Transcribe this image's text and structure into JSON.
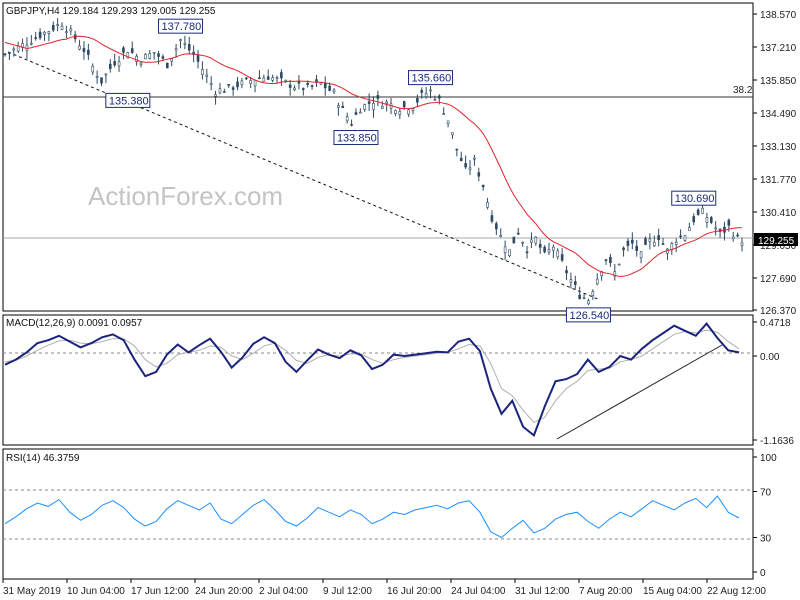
{
  "header": {
    "price_title": "GBPJPY,H4  129.184 129.293 129.005 129.255",
    "macd_title": "MACD(12,26,9) 0.0091 0.0957",
    "rsi_title": "RSI(14) 46.3759"
  },
  "watermark": "ActionForex.com",
  "colors": {
    "candles": "#2e4a62",
    "ma": "#e0242c",
    "macd": "#1a237e",
    "signal": "#b0b0b0",
    "rsi": "#1e90ff",
    "label_border": "#1a2c7a",
    "grid": "#c0c0c0"
  },
  "chart_data": [
    {
      "type": "candlestick",
      "symbol": "GBPJPY",
      "timeframe": "H4",
      "ohlc_last": {
        "open": 129.184,
        "high": 129.293,
        "low": 129.005,
        "close": 129.255
      },
      "ylim": [
        126.37,
        138.57
      ],
      "y_ticks": [
        "138.570",
        "137.210",
        "135.850",
        "134.490",
        "133.130",
        "131.770",
        "130.410",
        "129.050",
        "127.690",
        "126.370"
      ],
      "current_price": "129.255",
      "fib_level": {
        "label": "38.2",
        "value": 135.2
      },
      "moving_average_color": "#e0242c",
      "annotations": [
        {
          "text": "137.780",
          "value": 137.78
        },
        {
          "text": "135.380",
          "value": 135.38
        },
        {
          "text": "135.660",
          "value": 135.66
        },
        {
          "text": "133.850",
          "value": 133.85
        },
        {
          "text": "130.690",
          "value": 130.69
        },
        {
          "text": "126.540",
          "value": 126.54
        }
      ],
      "close_path": [
        [
          0,
          136.9
        ],
        [
          4,
          137.3
        ],
        [
          8,
          137.7
        ],
        [
          11,
          138.0
        ],
        [
          13,
          138.2
        ],
        [
          15,
          137.8
        ],
        [
          18,
          137.1
        ],
        [
          20,
          136.4
        ],
        [
          22,
          135.8
        ],
        [
          25,
          136.6
        ],
        [
          28,
          137.1
        ],
        [
          31,
          136.7
        ],
        [
          34,
          137.0
        ],
        [
          37,
          136.5
        ],
        [
          40,
          137.5
        ],
        [
          43,
          136.9
        ],
        [
          46,
          136.0
        ],
        [
          48,
          135.4
        ],
        [
          51,
          135.5
        ],
        [
          54,
          135.7
        ],
        [
          57,
          135.9
        ],
        [
          60,
          136.0
        ],
        [
          63,
          135.8
        ],
        [
          66,
          135.6
        ],
        [
          69,
          135.5
        ],
        [
          72,
          135.7
        ],
        [
          75,
          135.3
        ],
        [
          77,
          134.6
        ],
        [
          79,
          134.1
        ],
        [
          81,
          134.7
        ],
        [
          84,
          135.0
        ],
        [
          87,
          134.9
        ],
        [
          90,
          134.7
        ],
        [
          93,
          134.8
        ],
        [
          95,
          135.2
        ],
        [
          97,
          135.4
        ],
        [
          99,
          135.0
        ],
        [
          101,
          134.2
        ],
        [
          103,
          133.0
        ],
        [
          105,
          132.1
        ],
        [
          107,
          132.5
        ],
        [
          109,
          131.5
        ],
        [
          111,
          130.2
        ],
        [
          113,
          129.4
        ],
        [
          115,
          128.8
        ],
        [
          117,
          129.6
        ],
        [
          119,
          128.9
        ],
        [
          121,
          129.3
        ],
        [
          123,
          128.6
        ],
        [
          125,
          129.0
        ],
        [
          127,
          128.3
        ],
        [
          129,
          127.6
        ],
        [
          131,
          127.0
        ],
        [
          133,
          126.8
        ],
        [
          135,
          127.7
        ],
        [
          137,
          128.5
        ],
        [
          139,
          127.9
        ],
        [
          141,
          128.8
        ],
        [
          143,
          129.1
        ],
        [
          145,
          128.6
        ],
        [
          147,
          129.2
        ],
        [
          149,
          129.4
        ],
        [
          151,
          128.8
        ],
        [
          153,
          129.3
        ],
        [
          155,
          129.5
        ],
        [
          157,
          130.1
        ],
        [
          159,
          130.4
        ],
        [
          161,
          130.0
        ],
        [
          163,
          129.5
        ],
        [
          165,
          129.8
        ],
        [
          167,
          129.3
        ],
        [
          168,
          129.255
        ]
      ]
    },
    {
      "type": "line",
      "title": "MACD(12,26,9) 0.0091 0.0957",
      "ylim": [
        -1.1636,
        0.4718
      ],
      "y_ticks": [
        "0.4718",
        "0.00",
        "-1.1636"
      ],
      "series": [
        {
          "name": "MACD",
          "values": [
            -0.12,
            -0.05,
            0.05,
            0.18,
            0.22,
            0.28,
            0.2,
            0.12,
            0.18,
            0.26,
            0.3,
            0.22,
            -0.05,
            -0.28,
            -0.22,
            0.02,
            0.16,
            0.05,
            0.15,
            0.24,
            0.06,
            -0.16,
            -0.02,
            0.17,
            0.26,
            0.18,
            -0.08,
            -0.22,
            -0.06,
            0.09,
            0.02,
            -0.03,
            0.08,
            0.01,
            -0.18,
            -0.12,
            0.02,
            0.0,
            0.02,
            0.04,
            0.06,
            0.05,
            0.2,
            0.24,
            0.07,
            -0.45,
            -0.8,
            -0.62,
            -0.98,
            -1.1,
            -0.7,
            -0.35,
            -0.32,
            -0.25,
            -0.05,
            -0.22,
            -0.15,
            0.0,
            -0.05,
            0.1,
            0.22,
            0.32,
            0.42,
            0.35,
            0.28,
            0.45,
            0.25,
            0.08,
            0.05
          ]
        },
        {
          "name": "Signal",
          "values": [
            -0.08,
            -0.06,
            0.0,
            0.08,
            0.15,
            0.21,
            0.22,
            0.18,
            0.17,
            0.2,
            0.24,
            0.24,
            0.14,
            -0.05,
            -0.15,
            -0.1,
            0.02,
            0.05,
            0.08,
            0.14,
            0.12,
            0.0,
            -0.05,
            0.04,
            0.14,
            0.18,
            0.08,
            -0.06,
            -0.1,
            -0.02,
            0.02,
            0.0,
            0.03,
            0.03,
            -0.05,
            -0.1,
            -0.05,
            -0.02,
            0.0,
            0.02,
            0.04,
            0.05,
            0.1,
            0.16,
            0.14,
            -0.1,
            -0.45,
            -0.55,
            -0.75,
            -0.92,
            -0.85,
            -0.62,
            -0.45,
            -0.35,
            -0.2,
            -0.18,
            -0.17,
            -0.08,
            -0.05,
            0.0,
            0.1,
            0.2,
            0.3,
            0.34,
            0.32,
            0.36,
            0.33,
            0.2,
            0.1
          ]
        }
      ],
      "trendline": [
        [
          54,
          -1.1
        ],
        [
          165,
          0.1
        ]
      ]
    },
    {
      "type": "line",
      "title": "RSI(14) 46.3759",
      "ylim": [
        0,
        100
      ],
      "y_ticks": [
        "100",
        "70",
        "30",
        "0"
      ],
      "levels": [
        70,
        30
      ],
      "series": [
        {
          "name": "RSI",
          "values": [
            42,
            48,
            55,
            60,
            57,
            63,
            52,
            45,
            50,
            58,
            62,
            56,
            46,
            40,
            44,
            55,
            62,
            58,
            54,
            60,
            46,
            42,
            50,
            58,
            63,
            54,
            44,
            40,
            47,
            56,
            52,
            48,
            54,
            50,
            42,
            46,
            52,
            50,
            54,
            56,
            58,
            55,
            60,
            62,
            52,
            35,
            30,
            38,
            45,
            34,
            38,
            46,
            50,
            52,
            44,
            38,
            46,
            52,
            48,
            55,
            62,
            58,
            54,
            60,
            64,
            56,
            66,
            52,
            47
          ]
        }
      ]
    }
  ],
  "x_axis": {
    "labels": [
      "31 May 2019",
      "10 Jun 04:00",
      "17 Jun 12:00",
      "24 Jun 20:00",
      "2 Jul 04:00",
      "9 Jul 12:00",
      "16 Jul 20:00",
      "24 Jul 04:00",
      "31 Jul 12:00",
      "7 Aug 20:00",
      "15 Aug 04:00",
      "22 Aug 12:00"
    ]
  }
}
